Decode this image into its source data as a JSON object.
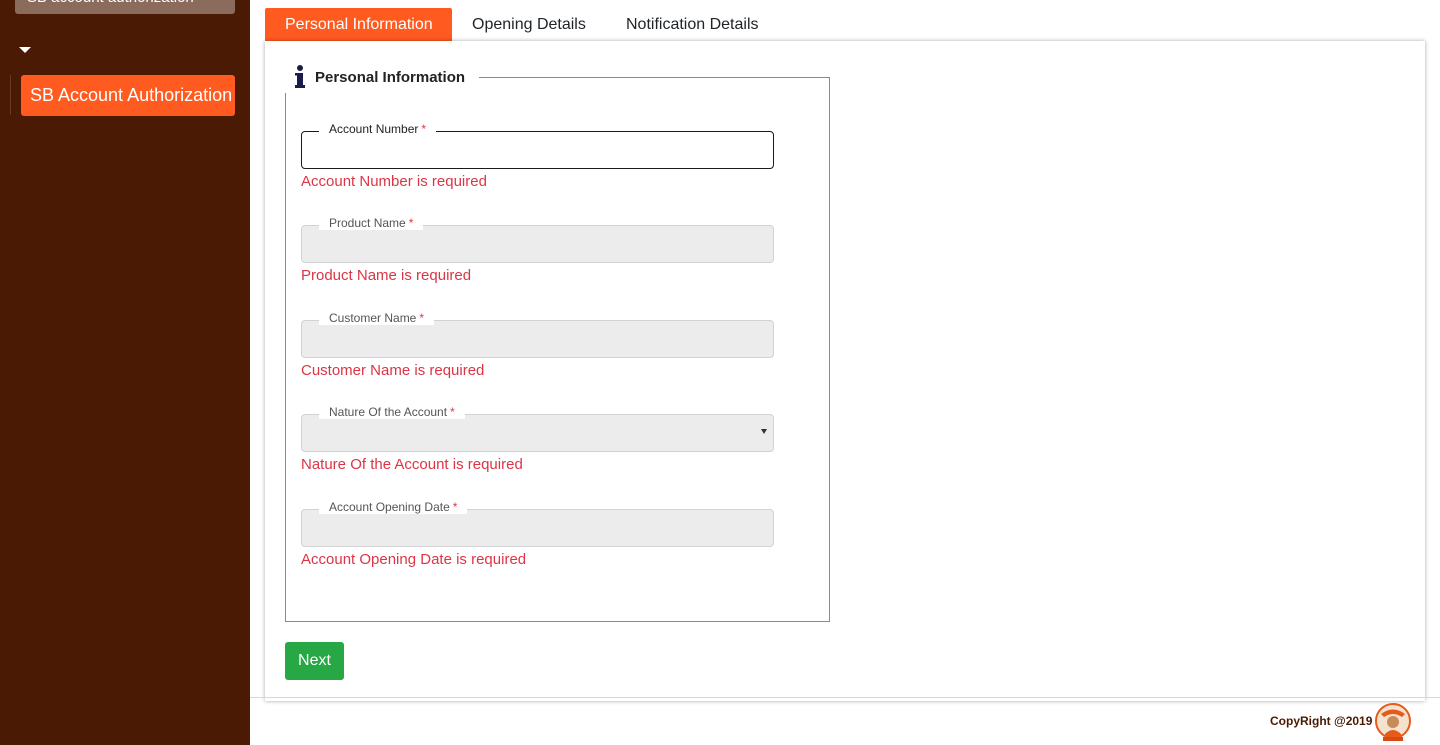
{
  "sidebar": {
    "search_text": "SB account authorization",
    "active_item": "SB Account Authorization"
  },
  "tabs": [
    {
      "label": "Personal Information",
      "active": true
    },
    {
      "label": "Opening Details",
      "active": false
    },
    {
      "label": "Notification Details",
      "active": false
    }
  ],
  "section": {
    "title": "Personal Information"
  },
  "fields": [
    {
      "label": "Account Number",
      "value": "",
      "error": "Account Number is required"
    },
    {
      "label": "Product Name",
      "value": "",
      "error": "Product Name is required"
    },
    {
      "label": "Customer Name",
      "value": "",
      "error": "Customer Name is required"
    },
    {
      "label": "Nature Of the Account",
      "value": "",
      "error": "Nature Of the Account is required"
    },
    {
      "label": "Account Opening Date",
      "value": "",
      "error": "Account Opening Date is required"
    }
  ],
  "required_mark": "*",
  "next_label": "Next",
  "footer": {
    "copyright": "CopyRight @2019"
  },
  "colors": {
    "sidebar_bg": "#4a1a04",
    "accent": "#ff5a1f",
    "error": "#dc3545",
    "success": "#28a745"
  },
  "icons": {
    "legend": "info-icon",
    "caret": "caret-down-icon",
    "search": "search-icon",
    "select": "chevron-down-icon"
  }
}
